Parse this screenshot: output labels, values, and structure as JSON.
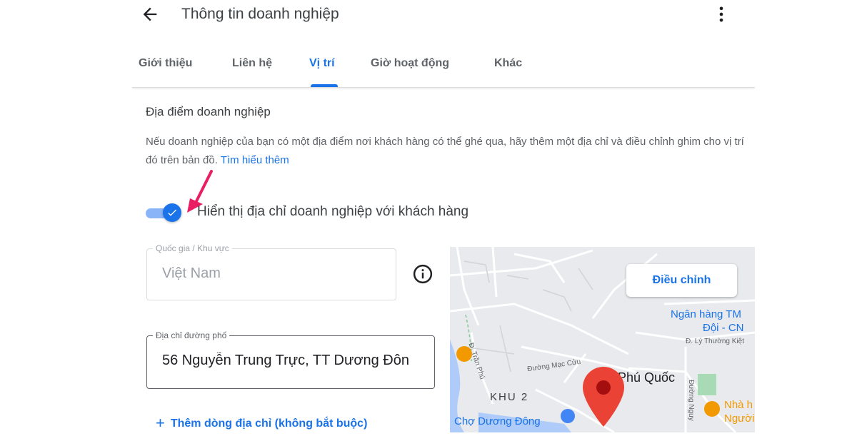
{
  "header": {
    "title": "Thông tin doanh nghiệp"
  },
  "tabs": [
    {
      "label": "Giới thiệu",
      "active": false
    },
    {
      "label": "Liên hệ",
      "active": false
    },
    {
      "label": "Vị trí",
      "active": true
    },
    {
      "label": "Giờ hoạt động",
      "active": false
    },
    {
      "label": "Khác",
      "active": false
    }
  ],
  "section": {
    "title": "Địa điểm doanh nghiệp",
    "description": "Nếu doanh nghiệp của bạn có một địa điểm nơi khách hàng có thể ghé qua, hãy thêm một địa chỉ và điều chỉnh ghim cho vị trí đó trên bản đồ.",
    "learn_more": "Tìm hiểu thêm"
  },
  "toggle": {
    "label": "Hiển thị địa chỉ doanh nghiệp với khách hàng",
    "checked": true
  },
  "fields": {
    "country": {
      "label": "Quốc gia / Khu vực",
      "value": "Việt Nam"
    },
    "street": {
      "label": "Địa chỉ đường phố",
      "value": "56 Nguyễn Trung Trực, TT Dương Đôn"
    }
  },
  "add_line": {
    "label": "Thêm dòng địa chỉ (không bắt buộc)"
  },
  "map": {
    "adjust_label": "Điều chỉnh",
    "labels": {
      "bank": "Ngân hàng TM",
      "bank_sub": "Đội - CN",
      "road_ly": "Đ. Lý Thường Kiệt",
      "road_tran": "Đ. Trần Phú",
      "road_mac": "Đường Mạc Cửu",
      "phu_quoc": "Phú Quốc",
      "khu2": "KHU 2",
      "market": "Chợ Dương Đông",
      "road_nguyen": "Đường Nguy",
      "restaurant": "Nhà h",
      "restaurant_sub": "Người"
    }
  },
  "colors": {
    "accent": "#1a73e8",
    "pin": "#ea4335",
    "annotation_arrow": "#e91e63"
  },
  "icons": {
    "back": "arrow-left-icon",
    "more": "more-vertical-icon",
    "info": "info-icon",
    "check": "check-icon",
    "pin": "map-pin-icon"
  }
}
